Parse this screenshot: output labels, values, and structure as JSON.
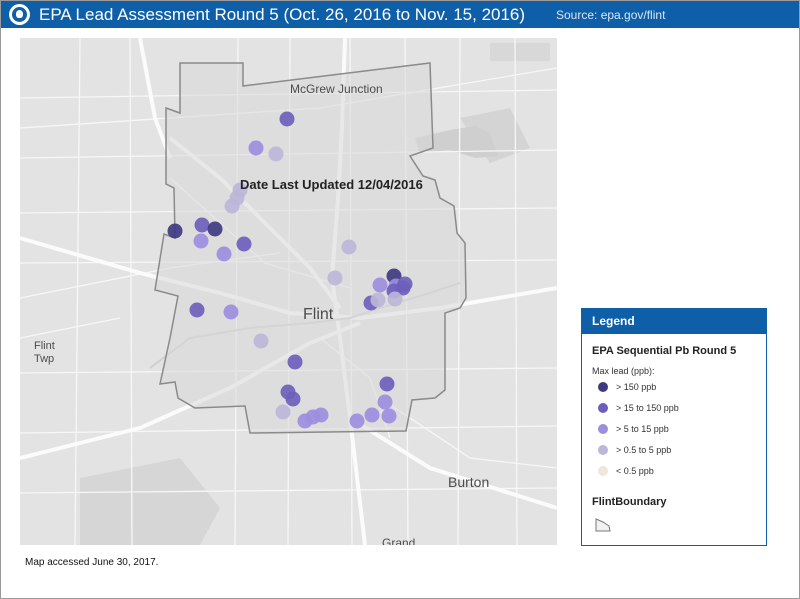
{
  "header": {
    "title": "EPA Lead Assessment Round 5 (Oct. 26, 2016 to Nov. 15, 2016)",
    "source": "Source: epa.gov/flint",
    "logo_icon": "epa-seal-icon"
  },
  "map": {
    "updated_label": "Date Last Updated 12/04/2016",
    "places": {
      "mcgrew": "McGrew Junction",
      "flint": "Flint",
      "flint_twp": "Flint Twp",
      "burton": "Burton",
      "grand": "Grand"
    },
    "colors": {
      "gt150": "#3e3a80",
      "15to150": "#6c5fbb",
      "5to15": "#9c8ddd",
      "0_5to5": "#bcb6d8",
      "lt0_5": "#efe6dc"
    }
  },
  "legend": {
    "title": "Legend",
    "layer": "EPA Sequential Pb Round 5",
    "field": "Max lead (ppb):",
    "classes": [
      {
        "label": "> 150 ppb",
        "color": "#3e3a80"
      },
      {
        "label": "> 15 to 150 ppb",
        "color": "#6c5fbb"
      },
      {
        "label": "> 5 to 15 ppb",
        "color": "#9c8ddd"
      },
      {
        "label": "> 0.5 to 5 ppb",
        "color": "#bcb6d8"
      },
      {
        "label": "< 0.5 ppb",
        "color": "#efe6dc"
      }
    ],
    "boundary_layer": "FlintBoundary"
  },
  "footnote": "Map accessed June 30, 2017."
}
